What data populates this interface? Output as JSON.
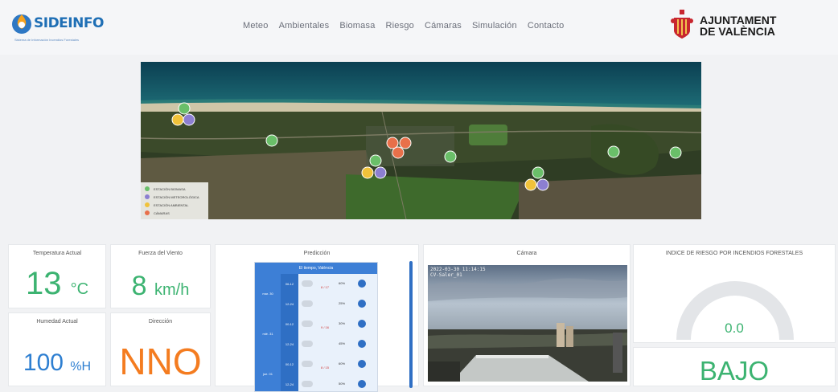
{
  "header": {
    "logo_text": "SIDEINFO",
    "logo_subtitle": "Sistema de Información Incendios Forestales",
    "nav": [
      "Meteo",
      "Ambientales",
      "Biomasa",
      "Riesgo",
      "Cámaras",
      "Simulación",
      "Contacto"
    ],
    "ajuntament_line1": "AJUNTAMENT",
    "ajuntament_line2": "DE VALÈNCIA"
  },
  "map": {
    "legend": [
      {
        "label": "ESTACIÓN BIOMASA",
        "color": "#6abf69"
      },
      {
        "label": "ESTACIÓN METEOROLÓGICA",
        "color": "#8c7fd1"
      },
      {
        "label": "ESTACIÓN AMBIENTAL",
        "color": "#f0c23a"
      },
      {
        "label": "CÁMARAS",
        "color": "#e8704a"
      }
    ]
  },
  "cards": {
    "temperature": {
      "title": "Temperatura Actual",
      "value": "13",
      "unit": "°C"
    },
    "wind_force": {
      "title": "Fuerza del Viento",
      "value": "8",
      "unit": "km/h"
    },
    "humidity": {
      "title": "Humedad Actual",
      "value": "100",
      "unit": "%H"
    },
    "direction": {
      "title": "Dirección",
      "value": "NNO"
    },
    "prediction": {
      "title": "Predicción",
      "widget_title": "El tiempo, València",
      "days": [
        {
          "label": "mar. 30",
          "rows": [
            {
              "time": "06-12",
              "temp": "8 / 17",
              "pct": "60%"
            },
            {
              "time": "12-24",
              "temp": "",
              "pct": "25%"
            }
          ]
        },
        {
          "label": "mié. 31",
          "rows": [
            {
              "time": "00-12",
              "temp": "9 / 16",
              "pct": "30%"
            },
            {
              "time": "12-24",
              "temp": "",
              "pct": "45%"
            }
          ]
        },
        {
          "label": "jue. 01",
          "rows": [
            {
              "time": "00-12",
              "temp": "8 / 15",
              "pct": "60%"
            },
            {
              "time": "12-24",
              "temp": "",
              "pct": "50%"
            }
          ]
        }
      ]
    },
    "camera": {
      "title": "Cámara",
      "stamp_line1": "2022-03-30 11:14:15",
      "stamp_line2": "CV-Saler_01"
    },
    "risk": {
      "title": "INDICE DE RIESGO POR INCENDIOS FORESTALES",
      "value": "0.0",
      "level": "BAJO",
      "value_fraction": 0.0
    }
  },
  "colors": {
    "green": "#3cb371",
    "blue": "#2e7fd1",
    "orange": "#f47c20"
  },
  "icons": {
    "logo": "flame-drop-icon",
    "coat_of_arms": "valencia-coat-of-arms-icon"
  }
}
